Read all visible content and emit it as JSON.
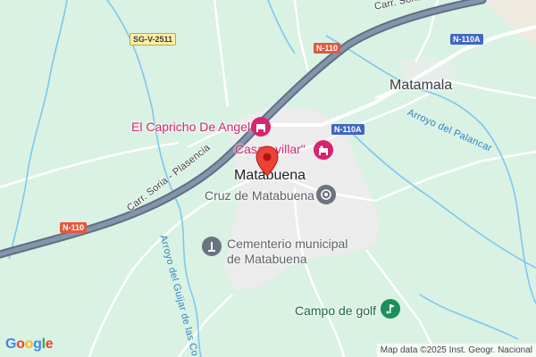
{
  "map": {
    "places": {
      "town": "Matabuena",
      "village": "Matamala"
    },
    "pois": {
      "restaurant": "El Capricho De Angel",
      "hotel": "Casa",
      "hotel_suffix": "villar\"",
      "landmark": "Cruz de Matabuena",
      "cemetery_line1": "Cementerio municipal",
      "cemetery_line2": "de Matabuena",
      "golf": "Campo de golf"
    },
    "roads": {
      "n110_a": "N-110",
      "n110_b": "N-110",
      "n110a_a": "N-110A",
      "n110a_b": "N-110A",
      "sgv": "SG-V-2511",
      "carr_top": "Carr. Soria - Plasencia",
      "carr_left": "Carr. Soria - Plasencia"
    },
    "waterways": {
      "arroyo_palancar": "Arroyo del Palancar",
      "arroyo_guijar": "Arroyo del Guijar de las Co"
    },
    "attribution": "Map data ©2025 Inst. Geogr. Nacional",
    "logo": {
      "letters": [
        "G",
        "o",
        "o",
        "g",
        "l",
        "e"
      ],
      "colors": [
        "#4285F4",
        "#EA4335",
        "#FBBC05",
        "#4285F4",
        "#34A853",
        "#EA4335"
      ]
    },
    "icons": {
      "restaurant": "restaurant-icon",
      "hotel": "hotel-icon",
      "landmark": "landmark-icon",
      "cemetery": "monument-icon",
      "golf": "golf-icon",
      "pin": "location-pin-icon"
    },
    "colors": {
      "land": "#d9f2e3",
      "urban": "#ececec",
      "highway": "#5e6f86",
      "water": "#7fc6f0",
      "poi_pink": "#d6246e",
      "poi_gray": "#6b7280",
      "poi_green": "#1e6b3a",
      "pin": "#ea4335"
    }
  }
}
